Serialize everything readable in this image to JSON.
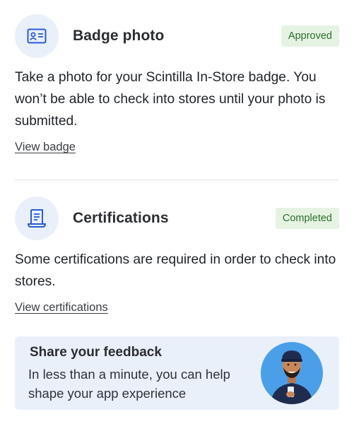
{
  "badge_section": {
    "title": "Badge photo",
    "status": "Approved",
    "description": "Take a photo for your Scintilla In-Store badge. You won’t be able to check into stores until your photo is submitted.",
    "link": "View badge",
    "icon": "id-card-icon"
  },
  "certifications_section": {
    "title": "Certifications",
    "status": "Completed",
    "description": "Some certifications are required in order to check into stores.",
    "link": "View certifications",
    "icon": "certificate-icon"
  },
  "feedback": {
    "title": "Share your feedback",
    "text": "In less than a minute, you can help shape your app experience"
  },
  "colors": {
    "accent": "#2a5bd7",
    "status_bg": "#e6f3e3",
    "status_text": "#2d6e2b",
    "card_bg": "#eaf0fa"
  }
}
